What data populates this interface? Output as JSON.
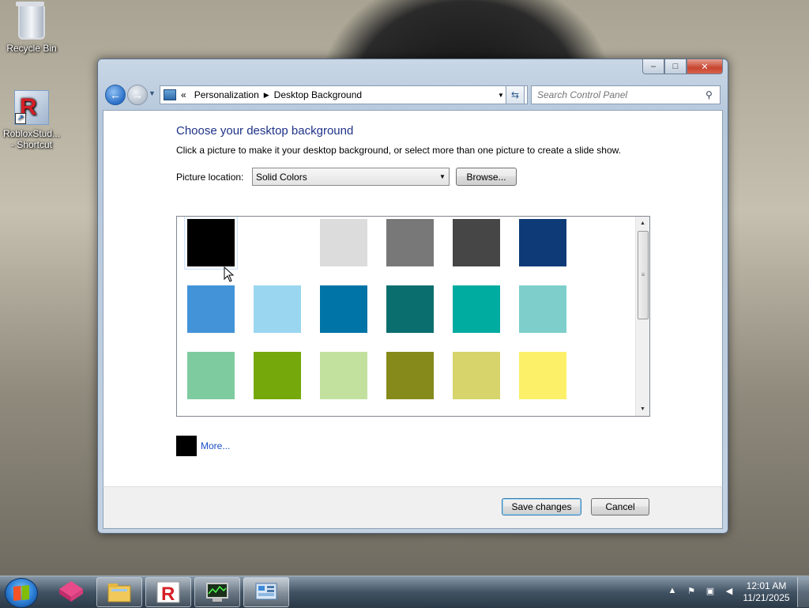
{
  "desktop": {
    "icons": [
      {
        "label": "Recycle Bin"
      },
      {
        "label": "RobloxStud...\n- Shortcut"
      }
    ]
  },
  "window": {
    "controls": {
      "minimize": "–",
      "maximize": "□",
      "close": "✕"
    },
    "breadcrumb": {
      "overflow": "«",
      "items": [
        "Personalization",
        "Desktop Background"
      ]
    },
    "search": {
      "placeholder": "Search Control Panel"
    },
    "title": "Choose your desktop background",
    "description": "Click a picture to make it your desktop background, or select more than one picture to create a slide show.",
    "picture_location": {
      "label": "Picture location:",
      "value": "Solid Colors",
      "browse_label": "Browse..."
    },
    "swatches": [
      "#000000",
      "#ffffff",
      "#dcdcdc",
      "#787878",
      "#464646",
      "#0e3a78",
      "#4393d8",
      "#9ad6ef",
      "#0074a6",
      "#0b6e6e",
      "#00aba0",
      "#7ecfcb",
      "#7ecba0",
      "#75a80b",
      "#c2e19f",
      "#858a1b",
      "#d6d46a",
      "#fcf069"
    ],
    "selected_swatch": 0,
    "more": {
      "color": "#000000",
      "label": "More..."
    },
    "footer": {
      "save_label": "Save changes",
      "cancel_label": "Cancel"
    }
  },
  "taskbar": {
    "pinned": [
      "libreoffice-icon",
      "file-explorer-icon",
      "roblox-icon",
      "task-manager-icon",
      "control-panel-icon"
    ],
    "clock": {
      "time": "12:01 AM",
      "date": "11/21/2025"
    }
  }
}
